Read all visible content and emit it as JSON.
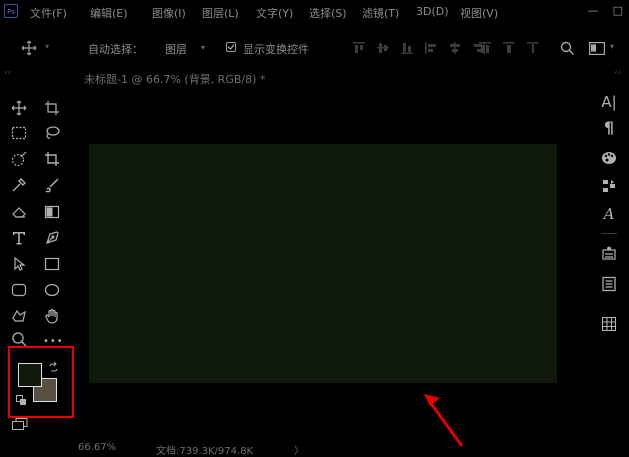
{
  "menubar": {
    "logo_text": "Ps",
    "items": [
      "文件(F)",
      "编辑(E)",
      "图像(I)",
      "图层(L)",
      "文字(Y)",
      "选择(S)",
      "滤镜(T)",
      "3D(D)",
      "视图(V)"
    ],
    "window_controls": [
      "—",
      "□"
    ]
  },
  "options": {
    "auto_select_label": "自动选择：",
    "auto_select_value": "图层",
    "show_transform_label": "显示变换控件",
    "show_transform_checked": true
  },
  "document": {
    "tab_title": "未标题-1 @ 66.7% (背景, RGB/8) *",
    "canvas_color": "#0f190c"
  },
  "colors": {
    "foreground": "#0f190c",
    "background": "#5a5042",
    "highlight": "#e60000"
  },
  "toolbar": {
    "more_label": "•••"
  },
  "status": {
    "zoom": "66.67%",
    "doc_info": "文档:739.3K/974.8K",
    "chevron": "〉"
  },
  "right_panel": {
    "character_label": "A|",
    "paragraph_label": "¶",
    "glyphs_label": "A"
  }
}
